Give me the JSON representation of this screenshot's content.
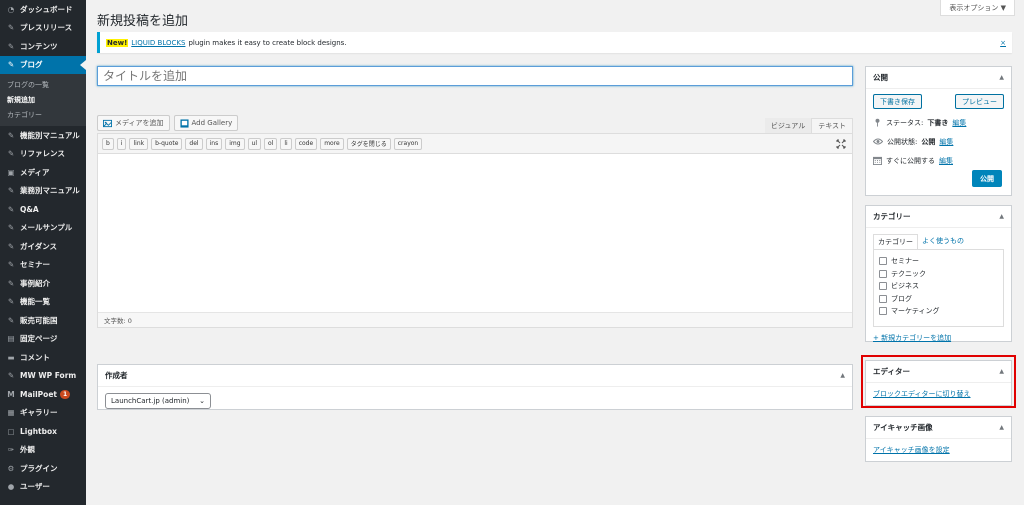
{
  "sidebar": {
    "items": [
      {
        "label": "ダッシュボード",
        "icon": "dashboard-icon"
      },
      {
        "label": "プレスリリース",
        "icon": "pin-icon"
      },
      {
        "label": "コンテンツ",
        "icon": "pin-icon"
      },
      {
        "label": "ブログ",
        "icon": "pin-icon",
        "active": true
      }
    ],
    "submenu": [
      "ブログの一覧",
      "新規追加",
      "カテゴリー"
    ],
    "items2": [
      {
        "label": "機能別マニュアル",
        "icon": "pin-icon"
      },
      {
        "label": "リファレンス",
        "icon": "pin-icon"
      },
      {
        "label": "メディア",
        "icon": "media-icon"
      },
      {
        "label": "業務別マニュアル",
        "icon": "pin-icon"
      },
      {
        "label": "Q&A",
        "icon": "pin-icon"
      },
      {
        "label": "メールサンプル",
        "icon": "pin-icon"
      },
      {
        "label": "ガイダンス",
        "icon": "pin-icon"
      },
      {
        "label": "セミナー",
        "icon": "pin-icon"
      },
      {
        "label": "事例紹介",
        "icon": "pin-icon"
      },
      {
        "label": "機能一覧",
        "icon": "pin-icon"
      },
      {
        "label": "販売可能国",
        "icon": "pin-icon"
      },
      {
        "label": "固定ページ",
        "icon": "page-icon"
      },
      {
        "label": "コメント",
        "icon": "comment-icon"
      },
      {
        "label": "MW WP Form",
        "icon": "pin-icon"
      },
      {
        "label": "MailPoet",
        "icon": "mailpoet-icon",
        "badge": "1"
      },
      {
        "label": "ギャラリー",
        "icon": "gallery-icon"
      },
      {
        "label": "Lightbox",
        "icon": "lightbox-icon"
      },
      {
        "label": "外観",
        "icon": "appearance-icon"
      },
      {
        "label": "プラグイン",
        "icon": "plugin-icon"
      },
      {
        "label": "ユーザー",
        "icon": "user-icon"
      }
    ]
  },
  "page_title": "新規投稿を追加",
  "screen_options": "表示オプション ▼",
  "notice": {
    "new": "New!",
    "link": "LIQUID BLOCKS",
    "text": "plugin makes it easy to create block designs.",
    "dismiss": "×"
  },
  "title_placeholder": "タイトルを追加",
  "media": {
    "add_media": "メディアを追加",
    "add_gallery": "Add Gallery"
  },
  "editor_tabs": [
    "ビジュアル",
    "テキスト"
  ],
  "quicktags": [
    "b",
    "i",
    "link",
    "b-quote",
    "del",
    "ins",
    "img",
    "ul",
    "ol",
    "li",
    "code",
    "more",
    "タグを閉じる",
    "crayon"
  ],
  "word_count": "文字数: 0",
  "author": {
    "title": "作成者",
    "value": "LaunchCart.jp (admin)"
  },
  "publish": {
    "title": "公開",
    "save_draft": "下書き保存",
    "preview": "プレビュー",
    "status_label": "ステータス:",
    "status_value": "下書き",
    "visibility_label": "公開状態:",
    "visibility_value": "公開",
    "schedule_label": "すぐに公開する",
    "edit": "編集",
    "publish_button": "公開"
  },
  "category": {
    "title": "カテゴリー",
    "tab_all": "カテゴリー",
    "tab_popular": "よく使うもの",
    "items": [
      "セミナー",
      "テクニック",
      "ビジネス",
      "ブログ",
      "マーケティング"
    ],
    "add_new": "+ 新規カテゴリーを追加"
  },
  "editor_box": {
    "title": "エディター",
    "link": "ブロックエディターに切り替え"
  },
  "thumbnail": {
    "title": "アイキャッチ画像",
    "link": "アイキャッチ画像を設定"
  },
  "colors": {
    "sidebar": "#23282d",
    "accent": "#0073aa",
    "highlight": "#e00000"
  }
}
